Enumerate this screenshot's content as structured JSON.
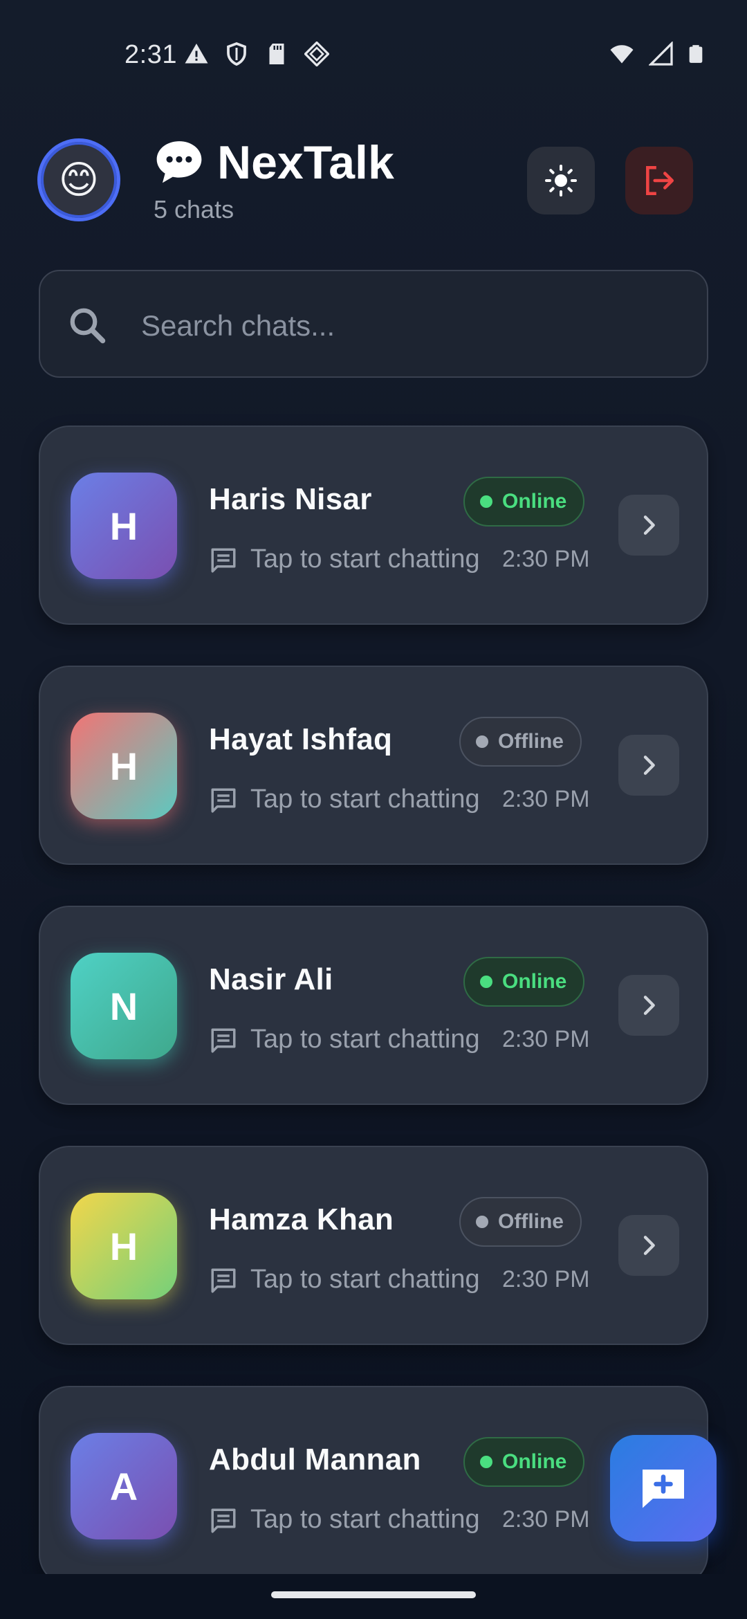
{
  "status_bar": {
    "time": "2:31",
    "left_icons": [
      "warning-icon",
      "shield-icon",
      "sd-card-icon",
      "diamond-app-icon"
    ],
    "right_icons": [
      "wifi-icon",
      "signal-icon",
      "battery-icon"
    ]
  },
  "header": {
    "avatar_emoji": "😊",
    "title": "NexTalk",
    "title_icon": "chat-bubble-icon",
    "subtitle": "5 chats",
    "theme_button_icon": "sun-icon",
    "logout_button_icon": "logout-icon"
  },
  "search": {
    "placeholder": "Search chats...",
    "value": ""
  },
  "chats": [
    {
      "initial": "H",
      "name": "Haris Nisar",
      "status": "Online",
      "preview": "Tap to start chatting",
      "time": "2:30 PM",
      "avatar_gradient": [
        "#6b7fe6",
        "#7a4fb0"
      ],
      "glow": "#5b6ee0"
    },
    {
      "initial": "H",
      "name": "Hayat Ishfaq",
      "status": "Offline",
      "preview": "Tap to start chatting",
      "time": "2:30 PM",
      "avatar_gradient": [
        "#f27474",
        "#5cc9c0"
      ],
      "glow": "#e06a6a"
    },
    {
      "initial": "N",
      "name": "Nasir Ali",
      "status": "Online",
      "preview": "Tap to start chatting",
      "time": "2:30 PM",
      "avatar_gradient": [
        "#4fd1c5",
        "#3fa88c"
      ],
      "glow": "#3fb8a8"
    },
    {
      "initial": "H",
      "name": "Hamza Khan",
      "status": "Offline",
      "preview": "Tap to start chatting",
      "time": "2:30 PM",
      "avatar_gradient": [
        "#f2d64b",
        "#74d07a"
      ],
      "glow": "#c9c24a"
    },
    {
      "initial": "A",
      "name": "Abdul Mannan",
      "status": "Online",
      "preview": "Tap to start chatting",
      "time": "2:30 PM",
      "avatar_gradient": [
        "#6b7fe6",
        "#7a4fb0"
      ],
      "glow": "#5b6ee0"
    }
  ],
  "fab": {
    "icon": "new-chat-icon"
  },
  "colors": {
    "accent": "#2a7de1",
    "online": "#4ade80",
    "logout": "#ef4444"
  }
}
